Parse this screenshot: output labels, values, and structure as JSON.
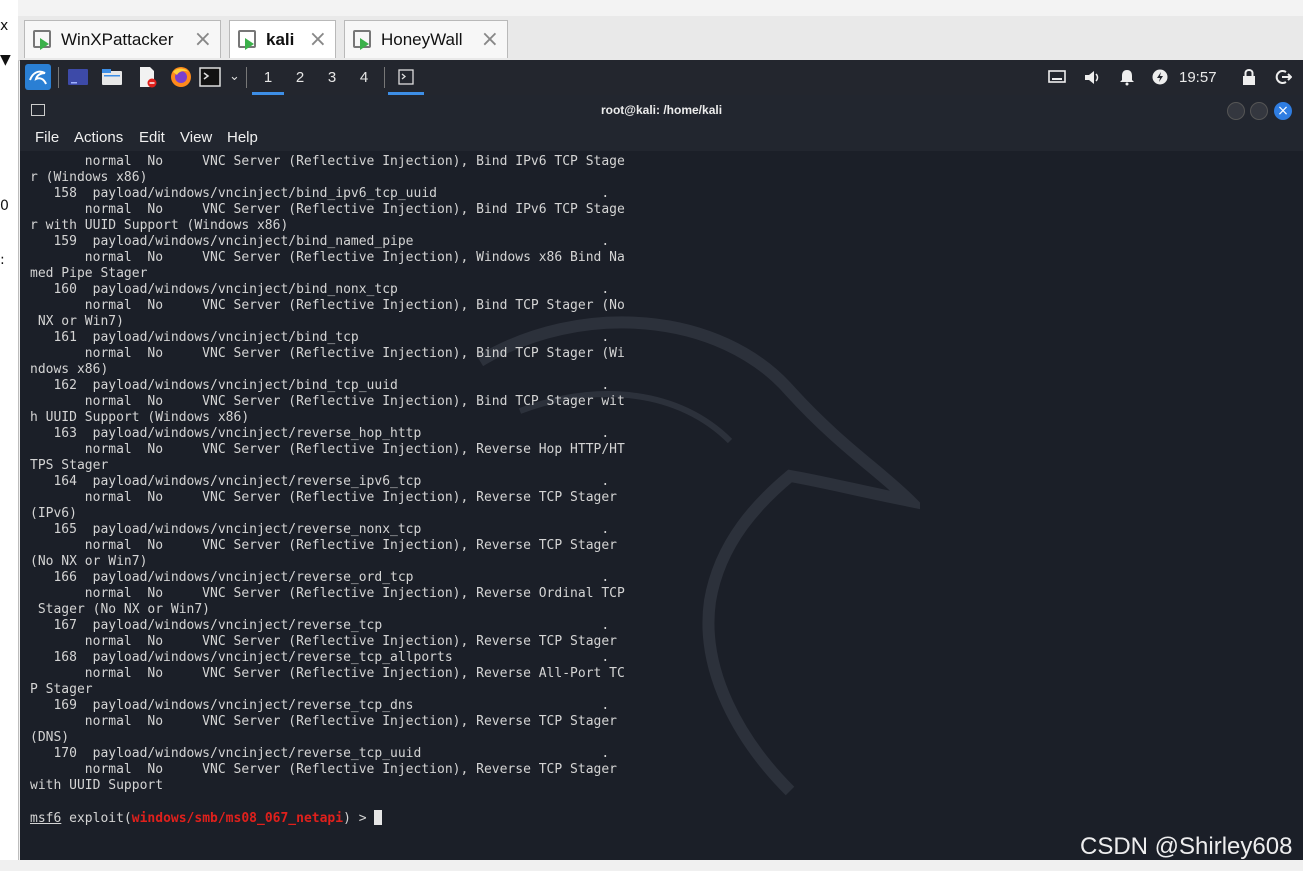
{
  "vm_tabs": [
    {
      "label": "WinXPattacker",
      "active": false
    },
    {
      "label": "kali",
      "active": true
    },
    {
      "label": "HoneyWall",
      "active": false
    }
  ],
  "panel": {
    "workspaces": [
      "1",
      "2",
      "3",
      "4"
    ],
    "active_workspace": "1",
    "clock": "19:57"
  },
  "terminal": {
    "title": "root@kali: /home/kali",
    "menu": [
      "File",
      "Actions",
      "Edit",
      "View",
      "Help"
    ],
    "lines": [
      "       normal  No     VNC Server (Reflective Injection), Bind IPv6 TCP Stage",
      "r (Windows x86)",
      "   158  payload/windows/vncinject/bind_ipv6_tcp_uuid                     .",
      "       normal  No     VNC Server (Reflective Injection), Bind IPv6 TCP Stage",
      "r with UUID Support (Windows x86)",
      "   159  payload/windows/vncinject/bind_named_pipe                        .",
      "       normal  No     VNC Server (Reflective Injection), Windows x86 Bind Na",
      "med Pipe Stager",
      "   160  payload/windows/vncinject/bind_nonx_tcp                          .",
      "       normal  No     VNC Server (Reflective Injection), Bind TCP Stager (No",
      " NX or Win7)",
      "   161  payload/windows/vncinject/bind_tcp                               .",
      "       normal  No     VNC Server (Reflective Injection), Bind TCP Stager (Wi",
      "ndows x86)",
      "   162  payload/windows/vncinject/bind_tcp_uuid                          .",
      "       normal  No     VNC Server (Reflective Injection), Bind TCP Stager wit",
      "h UUID Support (Windows x86)",
      "   163  payload/windows/vncinject/reverse_hop_http                       .",
      "       normal  No     VNC Server (Reflective Injection), Reverse Hop HTTP/HT",
      "TPS Stager",
      "   164  payload/windows/vncinject/reverse_ipv6_tcp                       .",
      "       normal  No     VNC Server (Reflective Injection), Reverse TCP Stager",
      "(IPv6)",
      "   165  payload/windows/vncinject/reverse_nonx_tcp                       .",
      "       normal  No     VNC Server (Reflective Injection), Reverse TCP Stager",
      "(No NX or Win7)",
      "   166  payload/windows/vncinject/reverse_ord_tcp                        .",
      "       normal  No     VNC Server (Reflective Injection), Reverse Ordinal TCP",
      " Stager (No NX or Win7)",
      "   167  payload/windows/vncinject/reverse_tcp                            .",
      "       normal  No     VNC Server (Reflective Injection), Reverse TCP Stager",
      "   168  payload/windows/vncinject/reverse_tcp_allports                   .",
      "       normal  No     VNC Server (Reflective Injection), Reverse All-Port TC",
      "P Stager",
      "   169  payload/windows/vncinject/reverse_tcp_dns                        .",
      "       normal  No     VNC Server (Reflective Injection), Reverse TCP Stager",
      "(DNS)",
      "   170  payload/windows/vncinject/reverse_tcp_uuid                       .",
      "       normal  No     VNC Server (Reflective Injection), Reverse TCP Stager",
      "with UUID Support"
    ],
    "prompt": {
      "prefix": "msf6",
      "command_start": " exploit(",
      "module": "windows/smb/ms08_067_netapi",
      "command_end": ") > "
    }
  },
  "watermark": "CSDN @Shirley608",
  "colors": {
    "panel_bg": "#23262e",
    "terminal_bg": "#1b1f28",
    "module_red": "#e0201c",
    "workspace_accent": "#3d8ee6",
    "close_button": "#2f7de1"
  },
  "icons": [
    "kali-menu-icon",
    "desktop-icon",
    "file-manager-icon",
    "text-editor-icon",
    "firefox-icon",
    "terminal-icon",
    "network-icon",
    "volume-icon",
    "bell-icon",
    "power-icon",
    "lock-icon",
    "logout-icon"
  ]
}
